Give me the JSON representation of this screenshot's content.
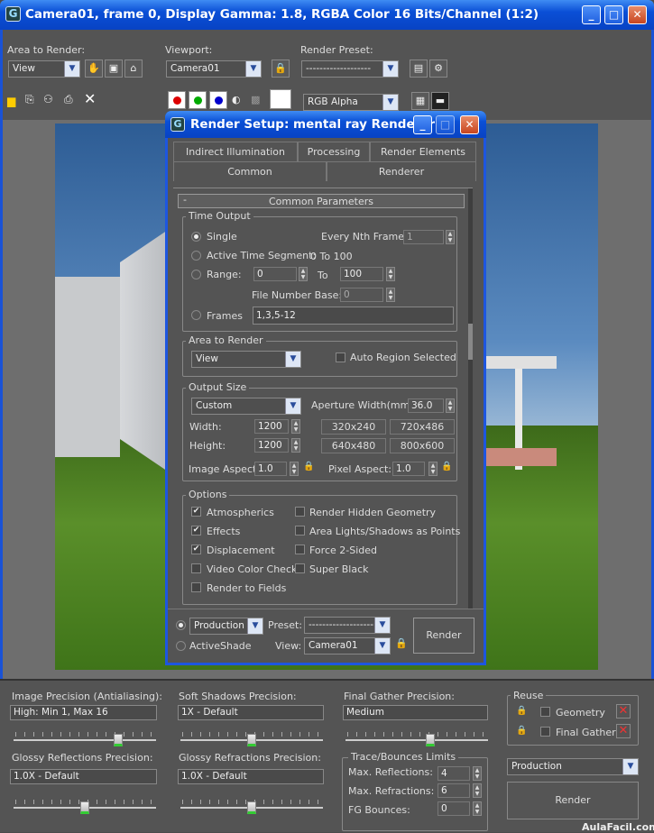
{
  "frame_window": {
    "title": "Camera01, frame 0, Display Gamma: 1.8, RGBA Color 16 Bits/Channel (1:2)"
  },
  "toolbar": {
    "area_label": "Area to Render:",
    "area_value": "View",
    "viewport_label": "Viewport:",
    "viewport_value": "Camera01",
    "preset_label": "Render Preset:",
    "preset_value": "-------------------",
    "channel_value": "RGB Alpha"
  },
  "dialog": {
    "title": "Render Setup: mental ray Renderer",
    "tabs_row1": [
      "Indirect Illumination",
      "Processing",
      "Render Elements"
    ],
    "tabs_row2": [
      "Common",
      "Renderer"
    ],
    "rollout_minus": "-",
    "rollout_title": "Common Parameters",
    "time_output": {
      "title": "Time Output",
      "single": "Single",
      "every_nth": "Every Nth Frame:",
      "every_nth_value": "1",
      "active_segment": "Active Time Segment:",
      "segment_value": "0 To 100",
      "range": "Range:",
      "range_from": "0",
      "to": "To",
      "range_to": "100",
      "file_number_base": "File Number Base:",
      "fnb_value": "0",
      "frames": "Frames",
      "frames_value": "1,3,5-12"
    },
    "area": {
      "title": "Area to Render",
      "value": "View",
      "auto_region": "Auto Region Selected"
    },
    "output_size": {
      "title": "Output Size",
      "preset": "Custom",
      "aperture_label": "Aperture Width(mm):",
      "aperture_value": "36.0",
      "width_label": "Width:",
      "width_value": "1200",
      "height_label": "Height:",
      "height_value": "1200",
      "sizes": [
        "320x240",
        "720x486",
        "640x480",
        "800x600"
      ],
      "image_aspect_label": "Image Aspect:",
      "image_aspect_value": "1.0",
      "pixel_aspect_label": "Pixel Aspect:",
      "pixel_aspect_value": "1.0"
    },
    "options": {
      "title": "Options",
      "left": [
        {
          "label": "Atmospherics",
          "checked": "✔"
        },
        {
          "label": "Effects",
          "checked": "✔"
        },
        {
          "label": "Displacement",
          "checked": "✔"
        },
        {
          "label": "Video Color Check",
          "checked": ""
        },
        {
          "label": "Render to Fields",
          "checked": ""
        }
      ],
      "right": [
        {
          "label": "Render Hidden Geometry"
        },
        {
          "label": "Area Lights/Shadows as Points"
        },
        {
          "label": "Force 2-Sided"
        },
        {
          "label": "Super Black"
        }
      ]
    },
    "footer": {
      "production": "Production",
      "activeshade": "ActiveShade",
      "preset_label": "Preset:",
      "preset_value": "-------------------",
      "view_label": "View:",
      "view_value": "Camera01",
      "render": "Render"
    }
  },
  "bottom": {
    "image_precision_label": "Image Precision (Antialiasing):",
    "image_precision_value": "High: Min 1, Max 16",
    "image_precision_level": 0.75,
    "soft_shadows_label": "Soft Shadows Precision:",
    "soft_shadows_value": "1X - Default",
    "soft_shadows_level": 0.5,
    "final_gather_label": "Final Gather Precision:",
    "final_gather_value": "Medium",
    "final_gather_level": 0.6,
    "glossy_refl_label": "Glossy Reflections Precision:",
    "glossy_refl_value": "1.0X - Default",
    "glossy_refl_level": 0.5,
    "glossy_refr_label": "Glossy Refractions Precision:",
    "glossy_refr_value": "1.0X - Default",
    "glossy_refr_level": 0.5,
    "trace_title": "Trace/Bounces Limits",
    "max_refl_label": "Max. Reflections:",
    "max_refl_value": "4",
    "max_refr_label": "Max. Refractions:",
    "max_refr_value": "6",
    "fg_bounces_label": "FG Bounces:",
    "fg_bounces_value": "0",
    "reuse_title": "Reuse",
    "geometry": "Geometry",
    "final_gather": "Final Gather",
    "mode_value": "Production",
    "render": "Render"
  },
  "watermark": "AulaFacil.com"
}
